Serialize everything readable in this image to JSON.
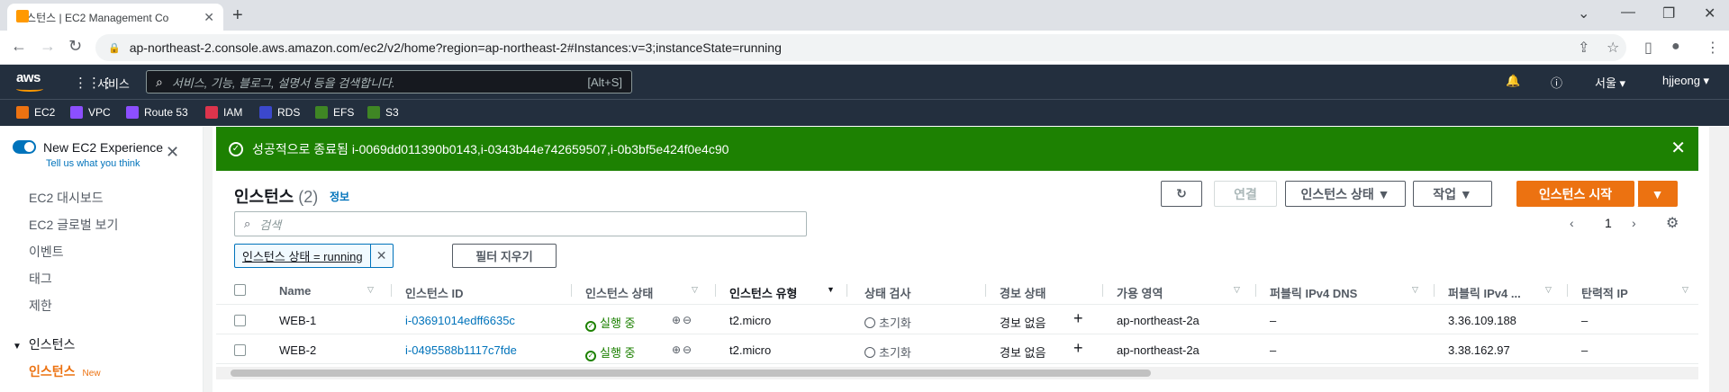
{
  "browser": {
    "tab_title": "인스턴스 | EC2 Management Co",
    "url": "ap-northeast-2.console.aws.amazon.com/ec2/v2/home?region=ap-northeast-2#Instances:v=3;instanceState=running"
  },
  "aws_header": {
    "logo": "aws",
    "services_label": "서비스",
    "search_placeholder": "서비스, 기능, 블로그, 설명서 등을 검색합니다.",
    "search_shortcut": "[Alt+S]",
    "region": "서울 ▾",
    "user": "hjjeong ▾"
  },
  "favorites": [
    {
      "label": "EC2",
      "color": "#ec7211"
    },
    {
      "label": "VPC",
      "color": "#8c4fff"
    },
    {
      "label": "Route 53",
      "color": "#8c4fff"
    },
    {
      "label": "IAM",
      "color": "#dd344c"
    },
    {
      "label": "RDS",
      "color": "#3b48cc"
    },
    {
      "label": "EFS",
      "color": "#3f8624"
    },
    {
      "label": "S3",
      "color": "#3f8624"
    }
  ],
  "sidebar": {
    "new_experience": "New EC2 Experience",
    "tell_us": "Tell us what you think",
    "items": [
      "EC2 대시보드",
      "EC2 글로벌 보기",
      "이벤트",
      "태그",
      "제한"
    ],
    "section": "인스턴스",
    "active_item": "인스턴스",
    "active_badge": "New"
  },
  "flash": {
    "message": "성공적으로 종료됨 i-0069dd011390b0143,i-0343b44e742659507,i-0b3bf5e424f0e4c90"
  },
  "panel": {
    "title": "인스턴스",
    "count": "(2)",
    "info": "정보",
    "connect_label": "연결",
    "state_label": "인스턴스 상태 ▼",
    "actions_label": "작업 ▼",
    "launch_label": "인스턴스 시작",
    "launch_dropdown": "▼",
    "search_placeholder": "검색",
    "page_number": "1",
    "filter_token": "인스턴스 상태 = running",
    "clear_filters": "필터 지우기"
  },
  "table": {
    "headers": [
      "Name",
      "인스턴스 ID",
      "인스턴스 상태",
      "인스턴스 유형",
      "상태 검사",
      "경보 상태",
      "가용 영역",
      "퍼블릭 IPv4 DNS",
      "퍼블릭 IPv4 ...",
      "탄력적 IP"
    ],
    "rows": [
      {
        "name": "WEB-1",
        "id": "i-03691014edff6635c",
        "state": "실행 중",
        "type": "t2.micro",
        "check": "초기화",
        "alarm": "경보 없음",
        "az": "ap-northeast-2a",
        "dns": "–",
        "ip": "3.36.109.188",
        "eip": "–"
      },
      {
        "name": "WEB-2",
        "id": "i-0495588b1117c7fde",
        "state": "실행 중",
        "type": "t2.micro",
        "check": "초기화",
        "alarm": "경보 없음",
        "az": "ap-northeast-2a",
        "dns": "–",
        "ip": "3.38.162.97",
        "eip": "–"
      }
    ]
  }
}
